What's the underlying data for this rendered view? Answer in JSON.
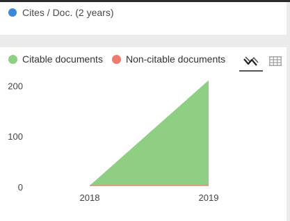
{
  "indicators_legend": {
    "items": [
      {
        "label": "Cites / Doc. (2 years)",
        "color": "#3b8ad9"
      }
    ]
  },
  "chart_controls": {
    "line_view_icon": "line-chart-icon",
    "table_view_icon": "table-grid-icon",
    "active_view": "chart"
  },
  "chart_data": {
    "type": "area",
    "x": [
      "2018",
      "2019"
    ],
    "series": [
      {
        "name": "Citable documents",
        "color": "#8fcf84",
        "values": [
          0,
          208
        ]
      },
      {
        "name": "Non-citable documents",
        "color": "#ef7a6f",
        "values": [
          0,
          0
        ]
      }
    ],
    "ylim": [
      0,
      210
    ],
    "yticks": [
      0,
      100,
      200
    ],
    "title": "",
    "xlabel": "",
    "ylabel": "",
    "legend_position": "top-left",
    "grid": false
  }
}
